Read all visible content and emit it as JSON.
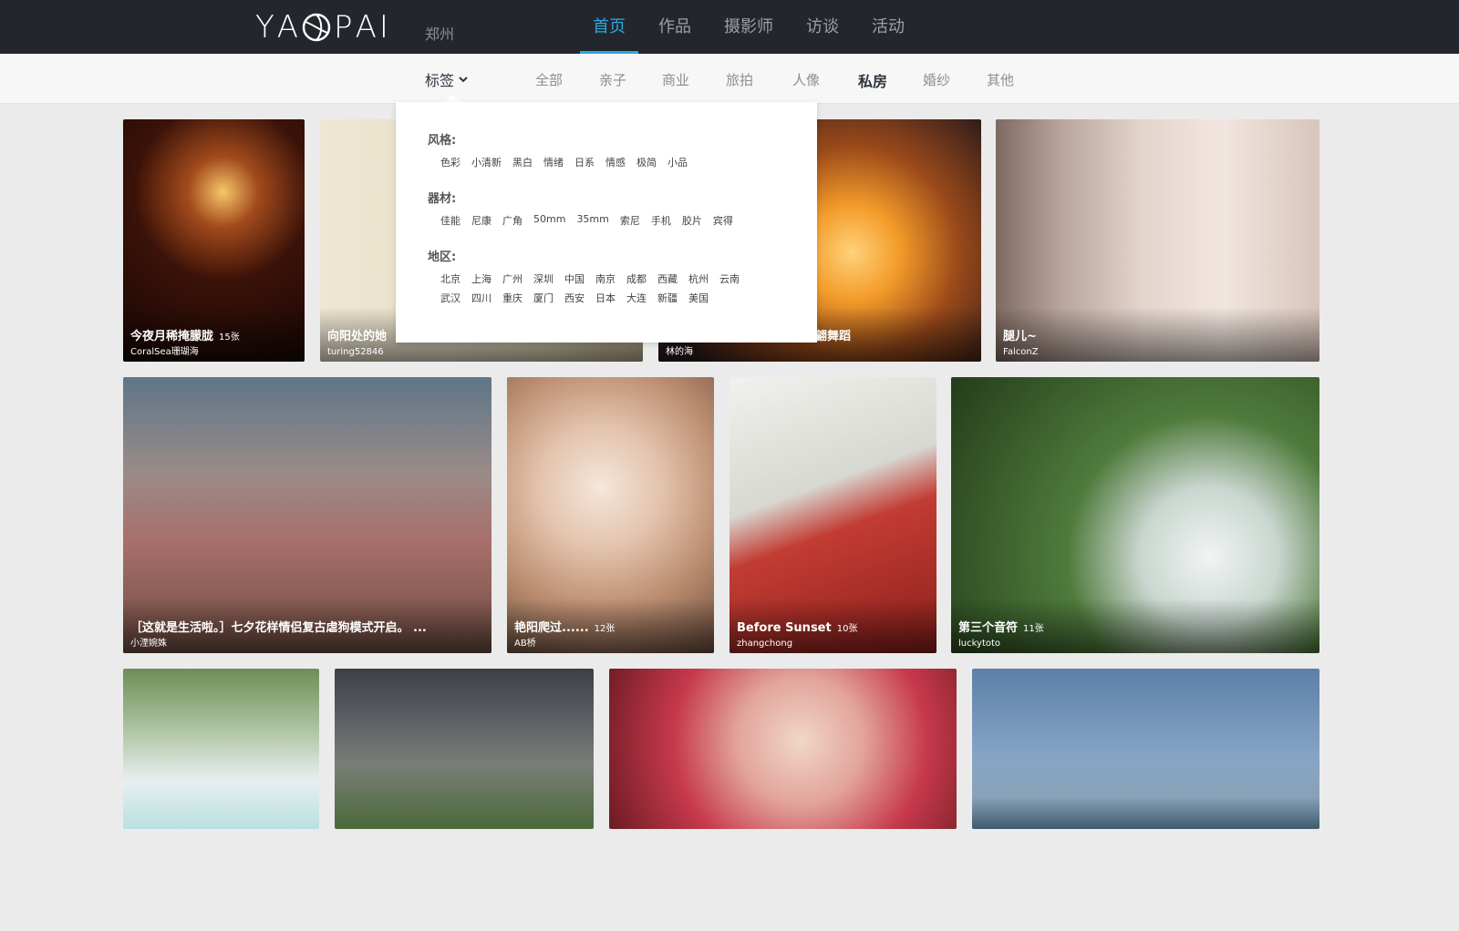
{
  "header": {
    "logo_letters": [
      "Y",
      "A",
      "P",
      "A",
      "I"
    ],
    "city": "郑州",
    "nav": [
      "首页",
      "作品",
      "摄影师",
      "访谈",
      "活动"
    ],
    "active_nav": "首页"
  },
  "categories": {
    "tags_label": "标签",
    "items": [
      "全部",
      "亲子",
      "商业",
      "旅拍",
      "人像",
      "私房",
      "婚纱",
      "其他"
    ],
    "bold_item": "私房"
  },
  "dropdown": {
    "groups": [
      {
        "title": "风格:",
        "rows": [
          [
            "色彩",
            "小清新",
            "黑白",
            "情绪",
            "日系",
            "情感",
            "极简",
            "小品"
          ]
        ]
      },
      {
        "title": "器材:",
        "rows": [
          [
            "佳能",
            "尼康",
            "广角",
            "50mm",
            "35mm",
            "索尼",
            "手机",
            "胶片",
            "宾得"
          ]
        ]
      },
      {
        "title": "地区:",
        "rows": [
          [
            "北京",
            "上海",
            "广州",
            "深圳",
            "中国",
            "南京",
            "成都",
            "西藏",
            "杭州",
            "云南"
          ],
          [
            "武汉",
            "四川",
            "重庆",
            "厦门",
            "西安",
            "日本",
            "大连",
            "新疆",
            "美国"
          ]
        ]
      }
    ]
  },
  "photos": [
    {
      "title": "今夜月稀掩朦胧",
      "count": "15张",
      "author": "CoralSea珊瑚海"
    },
    {
      "title": "向阳处的她",
      "count": "",
      "author": "turing52846"
    },
    {
      "title": "翩舞蹈",
      "count": "",
      "author": "林的海"
    },
    {
      "title": "腿儿~",
      "count": "",
      "author": "FalconZ"
    },
    {
      "title": "［这就是生活啦。］七夕花样情侣复古虐狗模式开启。 ...",
      "count": "",
      "author": "小湮婉姝"
    },
    {
      "title": "艳阳爬过......",
      "count": "12张",
      "author": "AB桥"
    },
    {
      "title": "Before Sunset",
      "count": "10张",
      "author": "zhangchong"
    },
    {
      "title": "第三个音符",
      "count": "11张",
      "author": "luckytoto"
    },
    {
      "title": "",
      "count": "",
      "author": ""
    },
    {
      "title": "",
      "count": "",
      "author": ""
    },
    {
      "title": "",
      "count": "",
      "author": ""
    },
    {
      "title": "",
      "count": "",
      "author": ""
    }
  ]
}
